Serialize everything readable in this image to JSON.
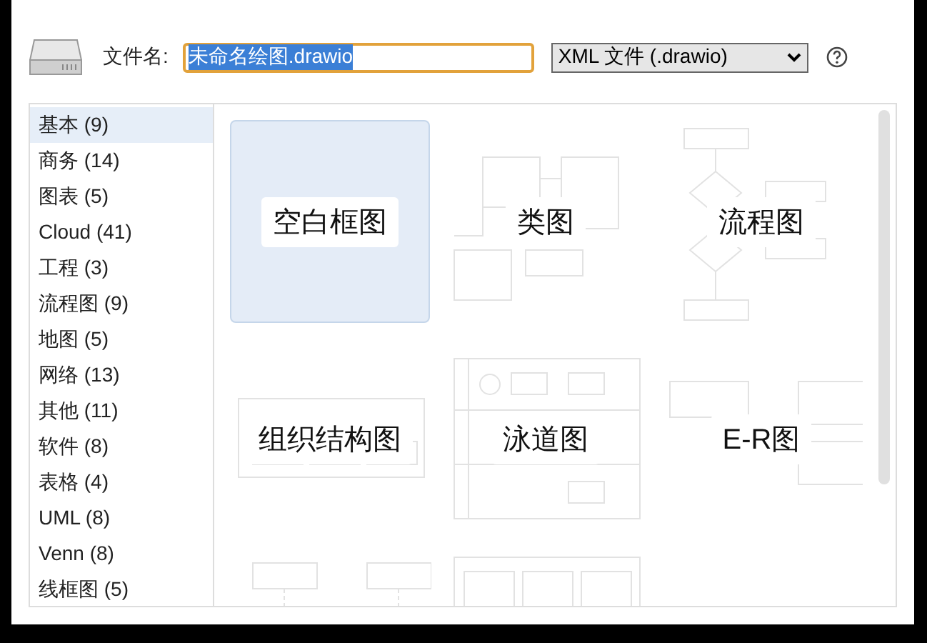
{
  "file_bar": {
    "label": "文件名:",
    "value": "未命名绘图.drawio",
    "text_selected": true,
    "format": "XML 文件 (.drawio)"
  },
  "categories": [
    {
      "label": "基本 (9)",
      "selected": true
    },
    {
      "label": "商务 (14)",
      "selected": false
    },
    {
      "label": "图表 (5)",
      "selected": false
    },
    {
      "label": "Cloud (41)",
      "selected": false
    },
    {
      "label": "工程 (3)",
      "selected": false
    },
    {
      "label": "流程图 (9)",
      "selected": false
    },
    {
      "label": "地图 (5)",
      "selected": false
    },
    {
      "label": "网络 (13)",
      "selected": false
    },
    {
      "label": "其他 (11)",
      "selected": false
    },
    {
      "label": "软件 (8)",
      "selected": false
    },
    {
      "label": "表格 (4)",
      "selected": false
    },
    {
      "label": "UML (8)",
      "selected": false
    },
    {
      "label": "Venn (8)",
      "selected": false
    },
    {
      "label": "线框图 (5)",
      "selected": false
    }
  ],
  "templates": [
    {
      "kind": "blank",
      "label": "空白框图",
      "selected": true
    },
    {
      "kind": "class",
      "label": "类图",
      "selected": false
    },
    {
      "kind": "flowchart",
      "label": "流程图",
      "selected": false
    },
    {
      "kind": "org",
      "label": "组织结构图",
      "selected": false
    },
    {
      "kind": "swimlane",
      "label": "泳道图",
      "selected": false
    },
    {
      "kind": "er",
      "label": "E-R图",
      "selected": false
    },
    {
      "kind": "sequence",
      "selected": false
    },
    {
      "kind": "kanban",
      "selected": false
    }
  ]
}
